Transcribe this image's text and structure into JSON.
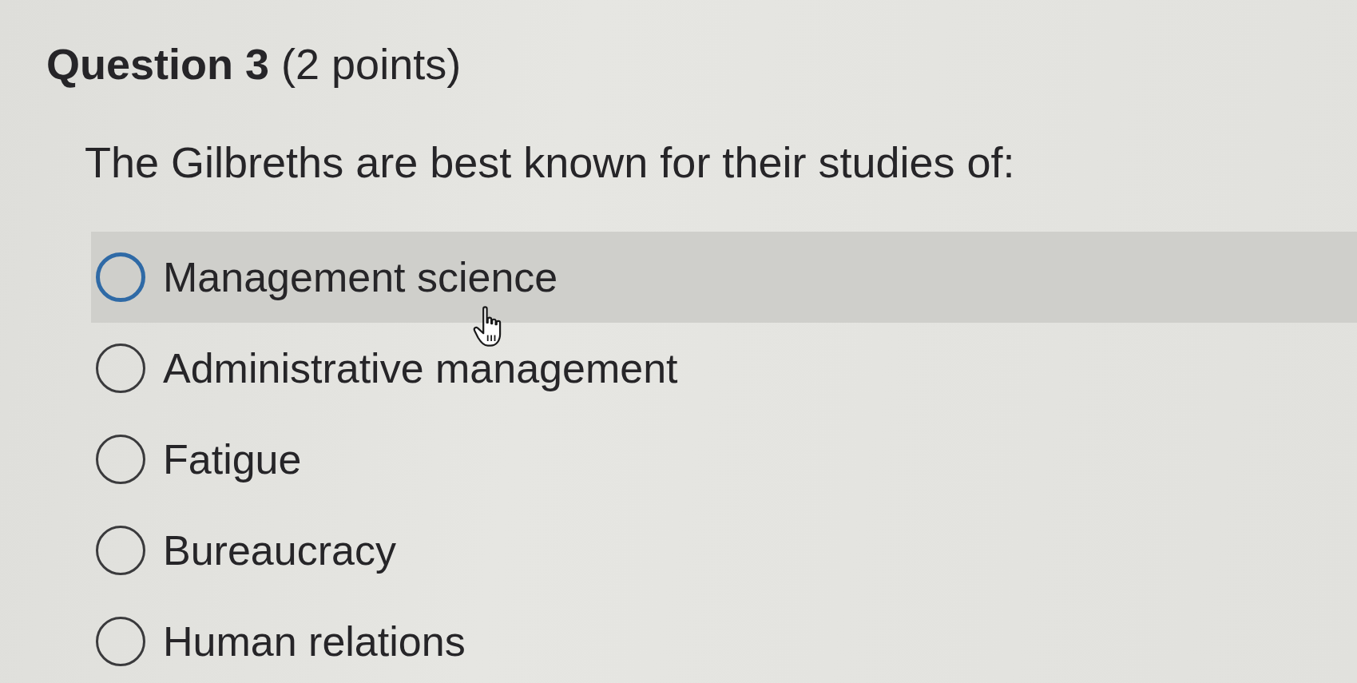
{
  "question": {
    "title": "**Question 3** (2 points)",
    "text": "The Gilbreths are best known for their studies of:"
  },
  "options": [
    {
      "label": "Management science",
      "selected": false,
      "hovered": true
    },
    {
      "label": "Administrative management",
      "selected": false,
      "hovered": false
    },
    {
      "label": "Fatigue",
      "selected": false,
      "hovered": false
    },
    {
      "label": "Bureaucracy",
      "selected": false,
      "hovered": false
    },
    {
      "label": "Human relations",
      "selected": false,
      "hovered": false
    }
  ]
}
